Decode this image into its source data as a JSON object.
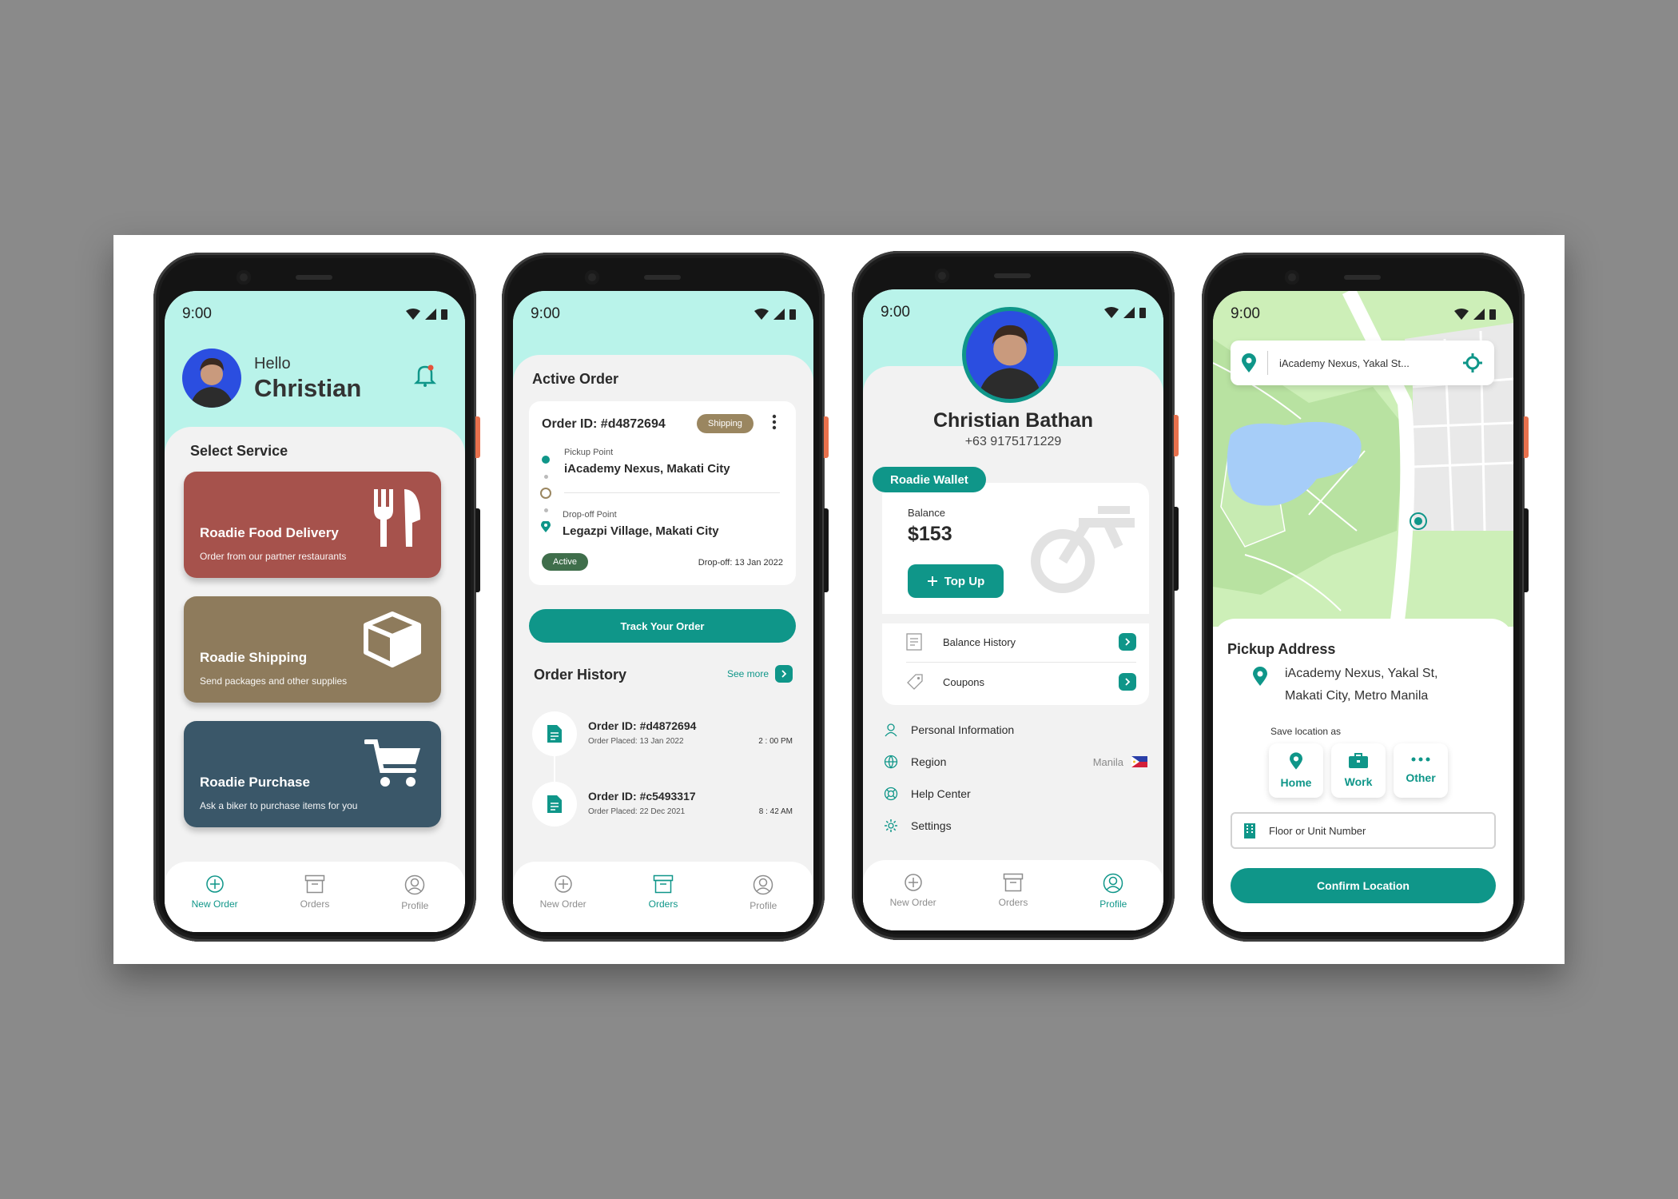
{
  "status_time": "9:00",
  "nav": {
    "new_order": "New Order",
    "orders": "Orders",
    "profile": "Profile"
  },
  "home": {
    "greeting": "Hello",
    "name": "Christian",
    "section_title": "Select Service",
    "services": [
      {
        "title": "Roadie Food Delivery",
        "subtitle": "Order from our partner restaurants",
        "color": "#a6524c",
        "icon": "fork-knife-icon"
      },
      {
        "title": "Roadie Shipping",
        "subtitle": "Send packages and other supplies",
        "color": "#8e7b5c",
        "icon": "box-icon"
      },
      {
        "title": "Roadie Purchase",
        "subtitle": "Ask a biker to purchase items for you",
        "color": "#3a5769",
        "icon": "cart-icon"
      }
    ]
  },
  "orders": {
    "active_title": "Active Order",
    "active": {
      "order_id": "Order ID: #d4872694",
      "status_badge": "Shipping",
      "pickup_label": "Pickup Point",
      "pickup": "iAcademy Nexus, Makati City",
      "dropoff_label": "Drop-off Point",
      "dropoff": "Legazpi Village, Makati City",
      "state_badge": "Active",
      "dropoff_date": "Drop-off: 13 Jan 2022"
    },
    "track_button": "Track Your Order",
    "history_title": "Order History",
    "see_more": "See more",
    "history": [
      {
        "order_id": "Order ID: #d4872694",
        "placed": "Order Placed: 13 Jan 2022",
        "time": "2 : 00 PM"
      },
      {
        "order_id": "Order ID: #c5493317",
        "placed": "Order Placed: 22 Dec 2021",
        "time": "8 : 42 AM"
      }
    ]
  },
  "profile": {
    "name": "Christian Bathan",
    "phone": "+63 9175171229",
    "wallet_tab": "Roadie Wallet",
    "balance_label": "Balance",
    "balance": "$153",
    "top_up": "Top Up",
    "wallet_links": [
      "Balance History",
      "Coupons"
    ],
    "menu": [
      {
        "label": "Personal Information",
        "icon": "user-icon"
      },
      {
        "label": "Region",
        "value": "Manila",
        "icon": "globe-icon"
      },
      {
        "label": "Help Center",
        "icon": "lifebuoy-icon"
      },
      {
        "label": "Settings",
        "icon": "gear-icon"
      }
    ]
  },
  "location": {
    "search_value": "iAcademy Nexus, Yakal St...",
    "title": "Pickup Address",
    "address_line1": "iAcademy Nexus, Yakal St,",
    "address_line2": "Makati City, Metro Manila",
    "save_as": "Save location as",
    "save_options": [
      "Home",
      "Work",
      "Other"
    ],
    "floor_placeholder": "Floor or Unit Number",
    "confirm": "Confirm Location"
  },
  "colors": {
    "accent": "#0f9689",
    "mint": "#b9f3ea",
    "shipping_badge": "#9a8660",
    "active_badge": "#3f6e4b"
  }
}
